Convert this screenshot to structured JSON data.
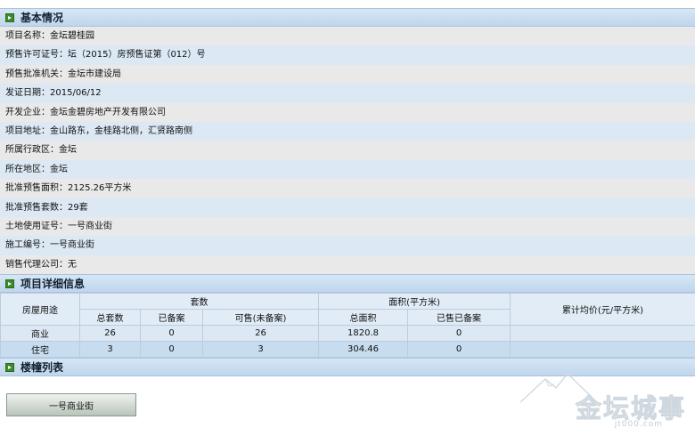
{
  "basic": {
    "title": "基本情况",
    "rows": [
      "项目名称：金坛碧桂园",
      "预售许可证号：坛（2015）房预售证第（012）号",
      "预售批准机关：金坛市建设局",
      "发证日期：2015/06/12",
      "开发企业：金坛金碧房地产开发有限公司",
      "项目地址：金山路东，金桂路北侧，汇贤路南侧",
      "所属行政区：金坛",
      "所在地区：金坛",
      "批准预售面积：2125.26平方米",
      "批准预售套数：29套",
      "土地使用证号：一号商业街",
      "施工编号：一号商业街",
      "销售代理公司：无"
    ]
  },
  "detail": {
    "title": "项目详细信息",
    "headers": {
      "usage": "房屋用途",
      "units": "套数",
      "area": "面积(平方米)",
      "avg_price": "累计均价(元/平方米)",
      "total_units": "总套数",
      "filed_units": "已备案",
      "available_units": "可售(未备案)",
      "total_area": "总面积",
      "sold_filed": "已售已备案"
    },
    "rows": [
      {
        "usage": "商业",
        "total": "26",
        "filed": "0",
        "available": "26",
        "area": "1820.8",
        "sold": "0",
        "avg": ""
      },
      {
        "usage": "住宅",
        "total": "3",
        "filed": "0",
        "available": "3",
        "area": "304.46",
        "sold": "0",
        "avg": ""
      }
    ]
  },
  "buildings": {
    "title": "楼幢列表",
    "button": "一号商业街"
  },
  "watermark": {
    "name": "金坛城事",
    "url": "jt000.com"
  }
}
